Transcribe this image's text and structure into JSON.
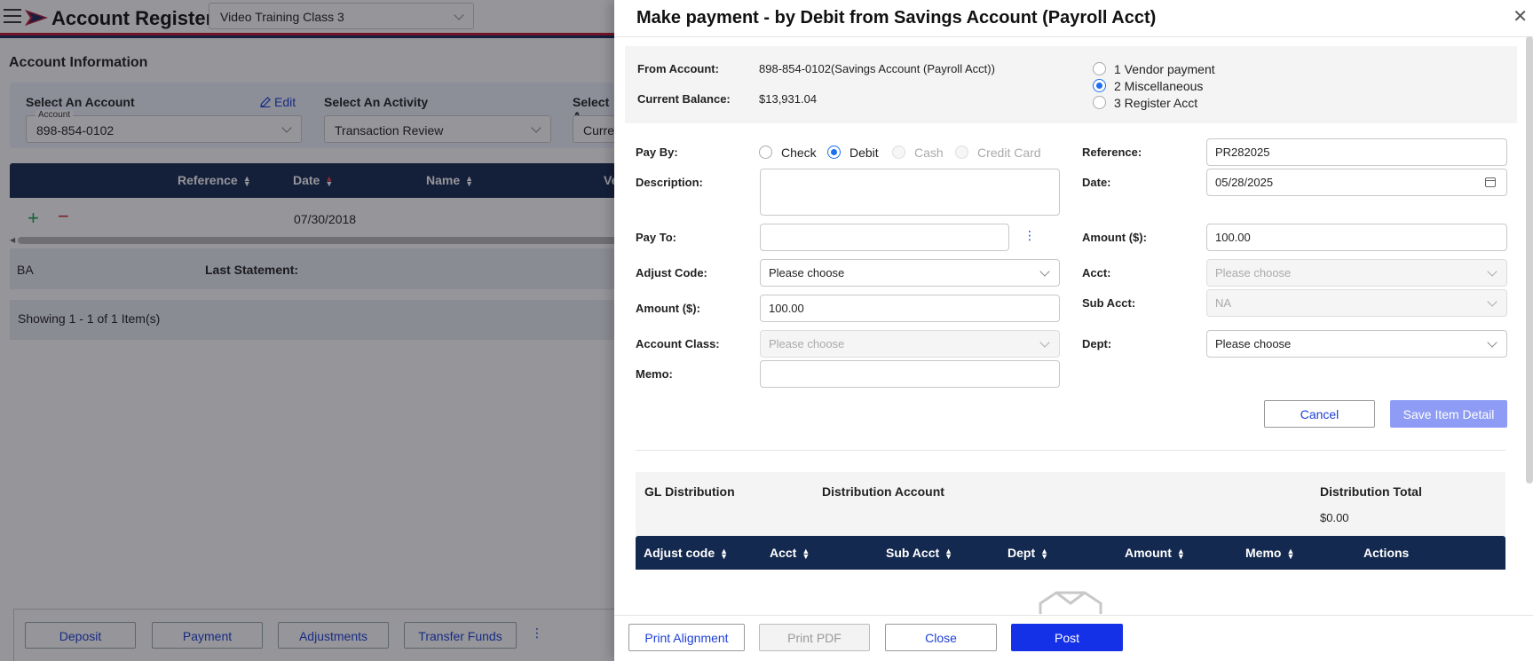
{
  "app": {
    "title": "Account Register",
    "class_select": "Video Training Class 3"
  },
  "account_info": {
    "title": "Account Information",
    "select_account_label": "Select An Account",
    "edit_label": "Edit",
    "account_legend": "Account",
    "account_value": "898-854-0102",
    "select_activity_label": "Select An Activity",
    "activity_value": "Transaction Review",
    "third_label": "Select A",
    "third_value": "Curre"
  },
  "register_table": {
    "columns": [
      "Reference",
      "Date",
      "Name",
      "Ve"
    ],
    "row_date": "07/30/2018",
    "summary_ba": "BA",
    "summary_last_statement": "Last Statement:",
    "showing": "Showing 1 - 1 of 1 Item(s)"
  },
  "bottom_buttons": {
    "deposit": "Deposit",
    "payment": "Payment",
    "adjustments": "Adjustments",
    "transfer": "Transfer Funds",
    "more": "⋮"
  },
  "modal": {
    "title": "Make payment - by Debit from Savings Account (Payroll Acct)",
    "from_account_label": "From Account:",
    "from_account_value": "898-854-0102(Savings Account (Payroll Acct))",
    "current_balance_label": "Current Balance:",
    "current_balance_value": "$13,931.04",
    "payment_types": [
      {
        "label": "1 Vendor payment",
        "selected": false
      },
      {
        "label": "2 Miscellaneous",
        "selected": true
      },
      {
        "label": "3 Register Acct",
        "selected": false
      }
    ],
    "pay_by_label": "Pay By:",
    "pay_by_options": [
      {
        "label": "Check",
        "selected": false,
        "disabled": false
      },
      {
        "label": "Debit",
        "selected": true,
        "disabled": false
      },
      {
        "label": "Cash",
        "selected": false,
        "disabled": true
      },
      {
        "label": "Credit Card",
        "selected": false,
        "disabled": true
      }
    ],
    "description_label": "Description:",
    "description_value": "",
    "pay_to_label": "Pay To:",
    "pay_to_value": "",
    "adjust_code_label": "Adjust Code:",
    "adjust_code_value": "Please choose",
    "amount_left_label": "Amount ($):",
    "amount_left_value": "100.00",
    "account_class_label": "Account Class:",
    "account_class_value": "Please choose",
    "memo_label": "Memo:",
    "memo_value": "",
    "reference_label": "Reference:",
    "reference_value": "PR282025",
    "date_label": "Date:",
    "date_value": "05/28/2025",
    "amount_right_label": "Amount ($):",
    "amount_right_value": "100.00",
    "acct_label": "Acct:",
    "acct_value": "Please choose",
    "sub_acct_label": "Sub Acct:",
    "sub_acct_value": "NA",
    "dept_label": "Dept:",
    "dept_value": "Please choose",
    "cancel_label": "Cancel",
    "save_item_label": "Save Item Detail",
    "gl_distribution_label": "GL Distribution",
    "distribution_account_label": "Distribution Account",
    "distribution_total_label": "Distribution Total",
    "distribution_total_value": "$0.00",
    "gl_columns": [
      "Adjust code",
      "Acct",
      "Sub Acct",
      "Dept",
      "Amount",
      "Memo",
      "Actions"
    ],
    "footer": {
      "print_alignment": "Print Alignment",
      "print_pdf": "Print PDF",
      "close": "Close",
      "post": "Post"
    }
  }
}
